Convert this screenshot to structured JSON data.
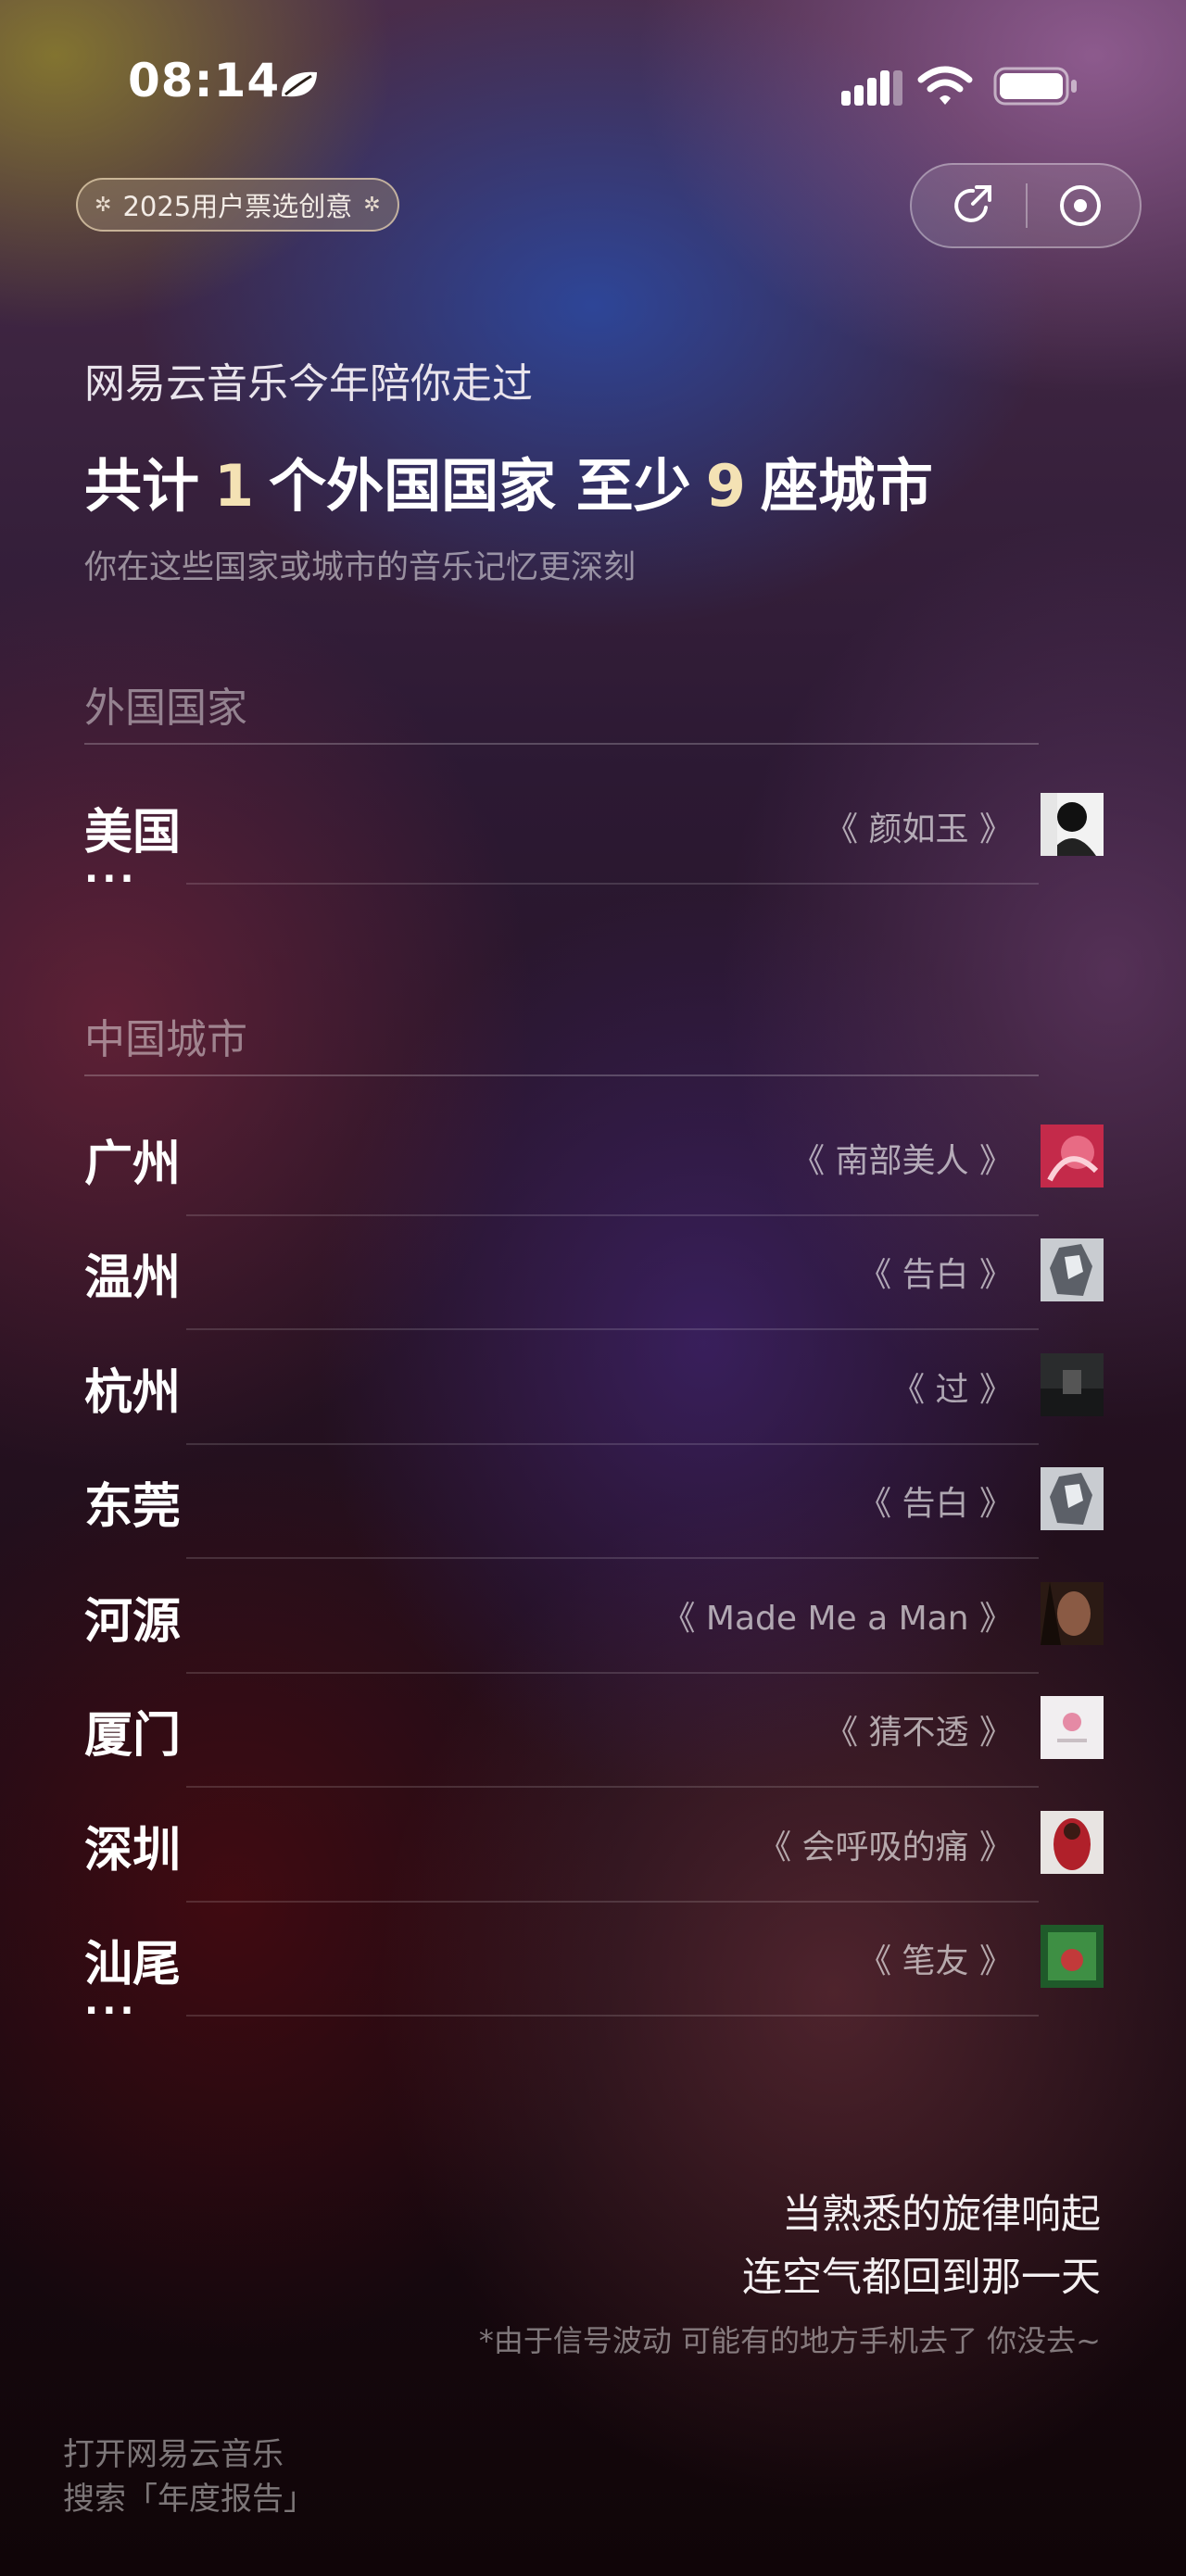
{
  "status_bar": {
    "time": "08:14",
    "icons": [
      "leaf-icon",
      "signal-icon",
      "wifi-icon",
      "battery-icon"
    ]
  },
  "badge": {
    "label": "2025用户票选创意",
    "star": "✲"
  },
  "capsule": {
    "icons": [
      "share-icon",
      "record-icon"
    ]
  },
  "intro": "网易云音乐今年陪你走过",
  "headline": {
    "part1": "共计",
    "num1": "1",
    "part2": "个外国国家 至少",
    "num2": "9",
    "part3": "座城市"
  },
  "subtitle": "你在这些国家或城市的音乐记忆更深刻",
  "foreign": {
    "title": "外国国家",
    "items": [
      {
        "city": "美国",
        "song": "《 颜如玉 》"
      }
    ],
    "more": "···"
  },
  "china": {
    "title": "中国城市",
    "items": [
      {
        "city": "广州",
        "song": "《 南部美人 》"
      },
      {
        "city": "温州",
        "song": "《 告白 》"
      },
      {
        "city": "杭州",
        "song": "《 过 》"
      },
      {
        "city": "东莞",
        "song": "《 告白 》"
      },
      {
        "city": "河源",
        "song": "《 Made Me a Man 》"
      },
      {
        "city": "厦门",
        "song": "《 猜不透 》"
      },
      {
        "city": "深圳",
        "song": "《 会呼吸的痛 》"
      },
      {
        "city": "汕尾",
        "song": "《 笔友 》"
      }
    ],
    "more": "···"
  },
  "closing": {
    "line1": "当熟悉的旋律响起",
    "line2": "连空气都回到那一天"
  },
  "note": "*由于信号波动 可能有的地方手机去了 你没去~",
  "footer": {
    "line1": "打开网易云音乐",
    "line2": "搜索「年度报告」"
  },
  "colors": {
    "highlight_number": "#f4e2b4"
  }
}
